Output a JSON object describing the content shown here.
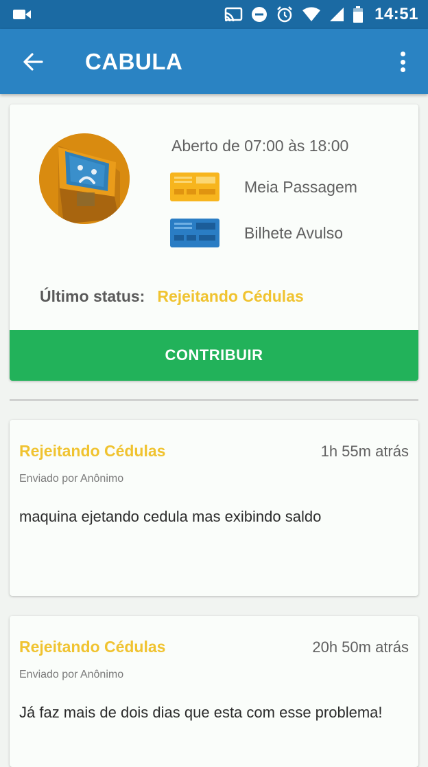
{
  "status_bar": {
    "time": "14:51",
    "icons": [
      "video-camera-icon",
      "cast-icon",
      "do-not-disturb-icon",
      "alarm-clock-icon",
      "wifi-icon",
      "signal-icon",
      "battery-icon"
    ]
  },
  "app_bar": {
    "title": "CABULA",
    "back_icon": "arrow-back-icon",
    "menu_icon": "more-vert-icon"
  },
  "info_card": {
    "avatar_icon": "sad-ticket-machine-icon",
    "hours": "Aberto de 07:00 às 18:00",
    "tickets": [
      {
        "label": "Meia Passagem",
        "icon": "yellow-ticket-card-icon",
        "color": "#f7b51e"
      },
      {
        "label": "Bilhete Avulso",
        "icon": "blue-ticket-card-icon",
        "color": "#2a7dc4"
      }
    ],
    "status_label": "Último status:",
    "status_value": "Rejeitando Cédulas",
    "contribute_label": "CONTRIBUIR"
  },
  "reports": [
    {
      "status": "Rejeitando Cédulas",
      "time": "1h 55m atrás",
      "author": "Enviado por Anônimo",
      "message": "maquina ejetando cedula mas exibindo saldo"
    },
    {
      "status": "Rejeitando Cédulas",
      "time": "20h 50m atrás",
      "author": "Enviado por Anônimo",
      "message": "Já faz mais de dois dias que esta com esse problema!"
    }
  ],
  "colors": {
    "status_bar": "#1b6aa3",
    "app_bar": "#2a83c3",
    "accent_yellow": "#f0c330",
    "button_green": "#22b25a",
    "avatar_orange": "#d98b10"
  }
}
